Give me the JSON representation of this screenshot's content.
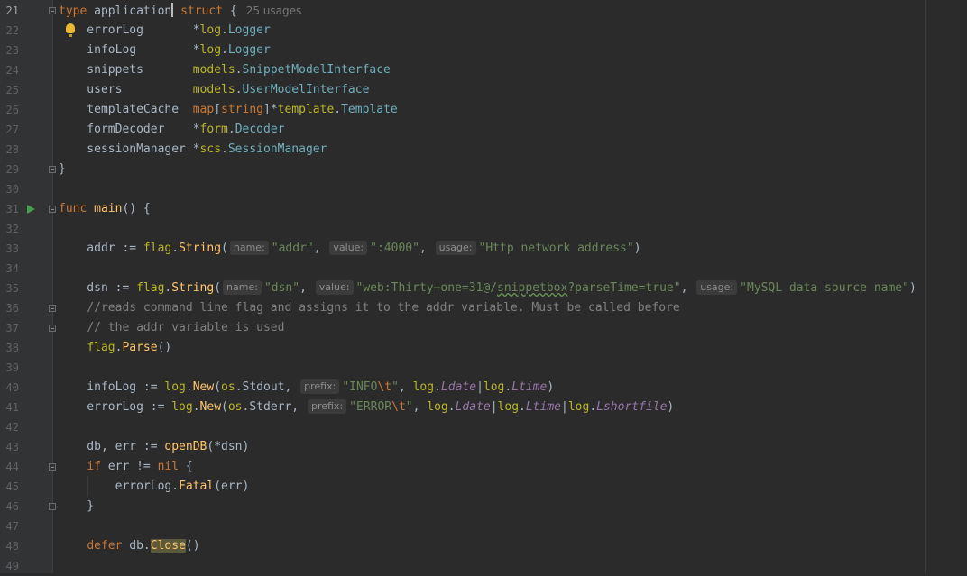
{
  "editor": {
    "language": "Go",
    "colors": {
      "background": "#2b2b2b",
      "keyword": "#cc7832",
      "function": "#ffc66d",
      "type": "#6fafbd",
      "string": "#6a8759",
      "comment": "#808080"
    },
    "lines": [
      {
        "n": "21",
        "current": true,
        "fold": true,
        "t": [
          [
            "k",
            "type "
          ],
          [
            "p",
            "applicatio"
          ],
          [
            "caret",
            "n"
          ],
          [
            "p",
            " "
          ],
          [
            "k",
            "struct"
          ],
          [
            "p",
            " {"
          ],
          [
            "usages",
            "25 usages"
          ]
        ]
      },
      {
        "n": "22",
        "bulb": true,
        "t": [
          [
            "p",
            "    errorLog       *"
          ],
          [
            "pk",
            "log"
          ],
          [
            "p",
            "."
          ],
          [
            "ty",
            "Logger"
          ]
        ]
      },
      {
        "n": "23",
        "t": [
          [
            "p",
            "    infoLog        *"
          ],
          [
            "pk",
            "log"
          ],
          [
            "p",
            "."
          ],
          [
            "ty",
            "Logger"
          ]
        ]
      },
      {
        "n": "24",
        "t": [
          [
            "p",
            "    snippets       "
          ],
          [
            "pk",
            "models"
          ],
          [
            "p",
            "."
          ],
          [
            "ty",
            "SnippetModelInterface"
          ]
        ]
      },
      {
        "n": "25",
        "t": [
          [
            "p",
            "    users          "
          ],
          [
            "pk",
            "models"
          ],
          [
            "p",
            "."
          ],
          [
            "ty",
            "UserModelInterface"
          ]
        ]
      },
      {
        "n": "26",
        "t": [
          [
            "p",
            "    templateCache  "
          ],
          [
            "k",
            "map"
          ],
          [
            "p",
            "["
          ],
          [
            "k",
            "string"
          ],
          [
            "p",
            "]*"
          ],
          [
            "pk",
            "template"
          ],
          [
            "p",
            "."
          ],
          [
            "ty",
            "Template"
          ]
        ]
      },
      {
        "n": "27",
        "t": [
          [
            "p",
            "    formDecoder    *"
          ],
          [
            "pk",
            "form"
          ],
          [
            "p",
            "."
          ],
          [
            "ty",
            "Decoder"
          ]
        ]
      },
      {
        "n": "28",
        "t": [
          [
            "p",
            "    sessionManager *"
          ],
          [
            "pk",
            "scs"
          ],
          [
            "p",
            "."
          ],
          [
            "ty",
            "SessionManager"
          ]
        ]
      },
      {
        "n": "29",
        "fold": true,
        "t": [
          [
            "p",
            "}"
          ]
        ]
      },
      {
        "n": "30",
        "t": []
      },
      {
        "n": "31",
        "run": true,
        "fold": true,
        "t": [
          [
            "k",
            "func "
          ],
          [
            "fn",
            "main"
          ],
          [
            "p",
            "() {"
          ]
        ]
      },
      {
        "n": "32",
        "t": []
      },
      {
        "n": "33",
        "t": [
          [
            "p",
            "    addr := "
          ],
          [
            "pk",
            "flag"
          ],
          [
            "p",
            "."
          ],
          [
            "fn",
            "String"
          ],
          [
            "p",
            "("
          ],
          [
            "hint",
            "name:"
          ],
          [
            "st",
            "\"addr\""
          ],
          [
            "p",
            ", "
          ],
          [
            "hint",
            "value:"
          ],
          [
            "st",
            "\":4000\""
          ],
          [
            "p",
            ", "
          ],
          [
            "hint",
            "usage:"
          ],
          [
            "st",
            "\"Http network address\""
          ],
          [
            "p",
            ")"
          ]
        ]
      },
      {
        "n": "34",
        "t": []
      },
      {
        "n": "35",
        "t": [
          [
            "p",
            "    dsn := "
          ],
          [
            "pk",
            "flag"
          ],
          [
            "p",
            "."
          ],
          [
            "fn",
            "String"
          ],
          [
            "p",
            "("
          ],
          [
            "hint",
            "name:"
          ],
          [
            "st",
            "\"dsn\""
          ],
          [
            "p",
            ", "
          ],
          [
            "hint",
            "value:"
          ],
          [
            "st",
            "\"web:Thirty+one=31@/"
          ],
          [
            "sq",
            "snippetbox"
          ],
          [
            "st",
            "?parseTime=true\""
          ],
          [
            "p",
            ", "
          ],
          [
            "hint",
            "usage:"
          ],
          [
            "st",
            "\"MySQL data source name\""
          ],
          [
            "p",
            ")"
          ]
        ]
      },
      {
        "n": "36",
        "fold": true,
        "t": [
          [
            "p",
            "    "
          ],
          [
            "cm",
            "//reads command line flag and assigns it to the addr variable. Must be called before"
          ]
        ]
      },
      {
        "n": "37",
        "fold": true,
        "t": [
          [
            "p",
            "    "
          ],
          [
            "cm",
            "// the addr variable is used"
          ]
        ]
      },
      {
        "n": "38",
        "t": [
          [
            "p",
            "    "
          ],
          [
            "pk",
            "flag"
          ],
          [
            "p",
            "."
          ],
          [
            "fn",
            "Parse"
          ],
          [
            "p",
            "()"
          ]
        ]
      },
      {
        "n": "39",
        "t": []
      },
      {
        "n": "40",
        "t": [
          [
            "p",
            "    infoLog := "
          ],
          [
            "pk",
            "log"
          ],
          [
            "p",
            "."
          ],
          [
            "fn",
            "New"
          ],
          [
            "p",
            "("
          ],
          [
            "pk",
            "os"
          ],
          [
            "p",
            ".Stdout, "
          ],
          [
            "hint",
            "prefix:"
          ],
          [
            "st",
            "\"INFO"
          ],
          [
            "esc",
            "\\t"
          ],
          [
            "st",
            "\""
          ],
          [
            "p",
            ", "
          ],
          [
            "pk",
            "log"
          ],
          [
            "p",
            "."
          ],
          [
            "cst",
            "Ldate"
          ],
          [
            "p",
            "|"
          ],
          [
            "pk",
            "log"
          ],
          [
            "p",
            "."
          ],
          [
            "cst",
            "Ltime"
          ],
          [
            "p",
            ")"
          ]
        ]
      },
      {
        "n": "41",
        "t": [
          [
            "p",
            "    errorLog := "
          ],
          [
            "pk",
            "log"
          ],
          [
            "p",
            "."
          ],
          [
            "fn",
            "New"
          ],
          [
            "p",
            "("
          ],
          [
            "pk",
            "os"
          ],
          [
            "p",
            ".Stderr, "
          ],
          [
            "hint",
            "prefix:"
          ],
          [
            "st",
            "\"ERROR"
          ],
          [
            "esc",
            "\\t"
          ],
          [
            "st",
            "\""
          ],
          [
            "p",
            ", "
          ],
          [
            "pk",
            "log"
          ],
          [
            "p",
            "."
          ],
          [
            "cst",
            "Ldate"
          ],
          [
            "p",
            "|"
          ],
          [
            "pk",
            "log"
          ],
          [
            "p",
            "."
          ],
          [
            "cst",
            "Ltime"
          ],
          [
            "p",
            "|"
          ],
          [
            "pk",
            "log"
          ],
          [
            "p",
            "."
          ],
          [
            "cst",
            "Lshortfile"
          ],
          [
            "p",
            ")"
          ]
        ]
      },
      {
        "n": "42",
        "t": []
      },
      {
        "n": "43",
        "t": [
          [
            "p",
            "    db, err := "
          ],
          [
            "fn",
            "openDB"
          ],
          [
            "p",
            "(*dsn)"
          ]
        ]
      },
      {
        "n": "44",
        "fold": true,
        "t": [
          [
            "p",
            "    "
          ],
          [
            "k",
            "if"
          ],
          [
            "p",
            " err != "
          ],
          [
            "k",
            "nil"
          ],
          [
            "p",
            " {"
          ]
        ]
      },
      {
        "n": "45",
        "t": [
          [
            "p",
            "        errorLog."
          ],
          [
            "fn",
            "Fatal"
          ],
          [
            "p",
            "(err)"
          ]
        ]
      },
      {
        "n": "46",
        "fold": true,
        "t": [
          [
            "p",
            "    }"
          ]
        ]
      },
      {
        "n": "47",
        "t": []
      },
      {
        "n": "48",
        "t": [
          [
            "p",
            "    "
          ],
          [
            "k",
            "defer"
          ],
          [
            "p",
            " db."
          ],
          [
            "hlfn",
            "Close"
          ],
          [
            "p",
            "()"
          ]
        ]
      },
      {
        "n": "49",
        "t": []
      }
    ]
  }
}
